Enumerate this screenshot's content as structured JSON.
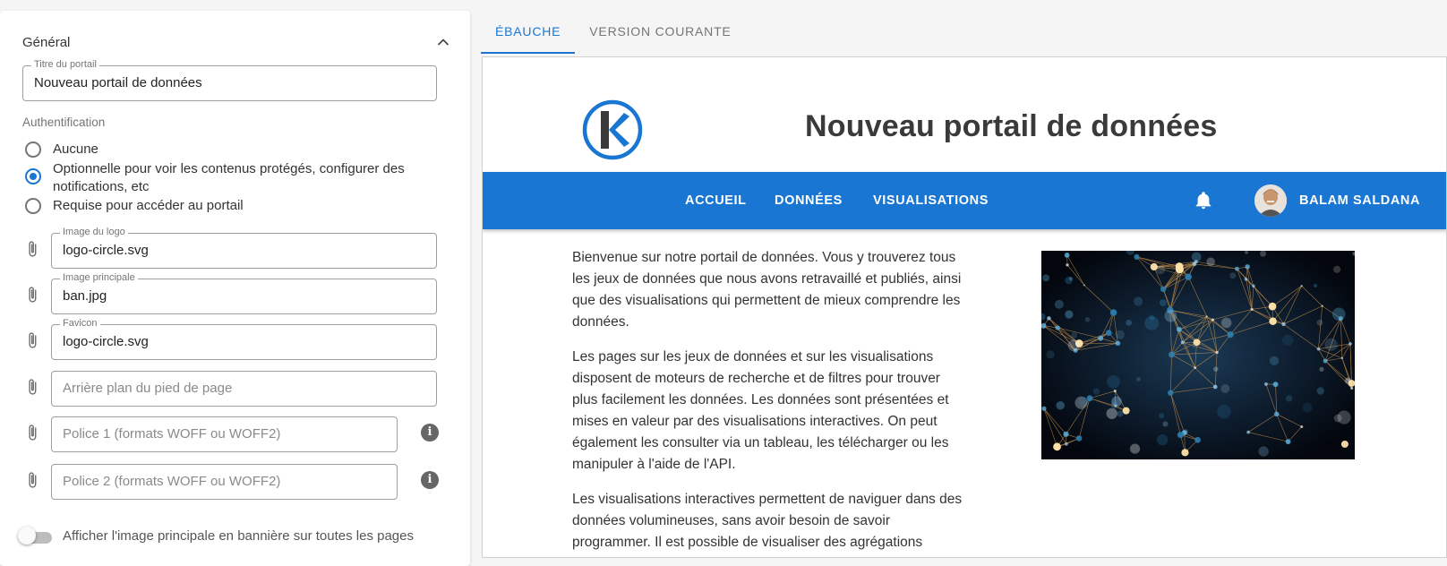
{
  "settings": {
    "section_title": "Général",
    "portal_title": {
      "label": "Titre du portail",
      "value": "Nouveau portail de données"
    },
    "auth": {
      "label": "Authentification",
      "options": [
        {
          "label": "Aucune",
          "checked": false
        },
        {
          "label": "Optionnelle pour voir les contenus protégés, configurer des notifications, etc",
          "checked": true
        },
        {
          "label": "Requise pour accéder au portail",
          "checked": false
        }
      ]
    },
    "logo_image": {
      "label": "Image du logo",
      "value": "logo-circle.svg"
    },
    "main_image": {
      "label": "Image principale",
      "value": "ban.jpg"
    },
    "favicon": {
      "label": "Favicon",
      "value": "logo-circle.svg"
    },
    "footer_bg": {
      "placeholder": "Arrière plan du pied de page"
    },
    "font1": {
      "placeholder": "Police 1 (formats WOFF ou WOFF2)"
    },
    "font2": {
      "placeholder": "Police 2 (formats WOFF ou WOFF2)"
    },
    "banner_toggle": {
      "label": "Afficher l'image principale en bannière sur toutes les pages",
      "checked": false
    }
  },
  "preview": {
    "tabs": [
      {
        "label": "ÉBAUCHE",
        "active": true
      },
      {
        "label": "VERSION COURANTE",
        "active": false
      }
    ],
    "title": "Nouveau portail de données",
    "logo_letter": "K",
    "nav": [
      "ACCUEIL",
      "DONNÉES",
      "VISUALISATIONS"
    ],
    "user_name": "BALAM SALDANA",
    "paragraphs": [
      "Bienvenue sur notre portail de données. Vous y trouverez tous les jeux de données que nous avons retravaillé et publiés, ainsi que des visualisations qui permettent de mieux comprendre les données.",
      "Les pages sur les jeux de données et sur les visualisations disposent de moteurs de recherche et de filtres pour trouver plus facilement les données. Les données sont présentées et mises en valeur par des visualisations interactives. On peut également les consulter via un tableau, les télécharger ou les manipuler à l'aide de l'API.",
      "Les visualisations interactives permettent de naviguer dans des données volumineuses, sans avoir besoin de savoir programmer. Il est possible de visualiser des agrégations"
    ]
  },
  "colors": {
    "primary": "#1976d2",
    "info_icon": "#666666",
    "toggle_track": "#bdbdbd"
  },
  "icons": {
    "chevron": "chevron-up-icon",
    "attach": "paperclip-icon",
    "info": "info-icon",
    "bell": "bell-icon"
  }
}
